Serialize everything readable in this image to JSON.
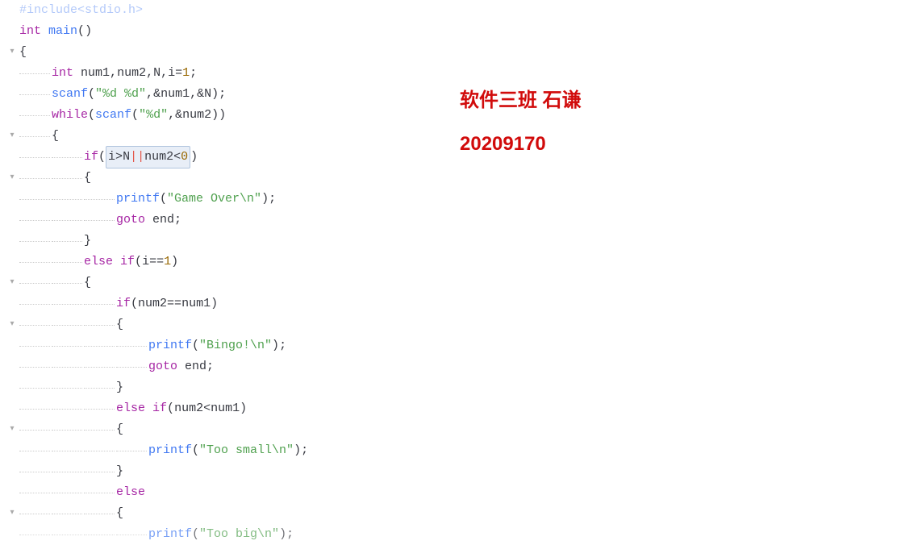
{
  "watermark": {
    "line1": "软件三班 石谦",
    "line2": "20209170"
  },
  "code": {
    "include_line": "#include<stdio.h>",
    "type_int": "int",
    "main_fn": "main",
    "open_paren": "(",
    "close_paren": ")",
    "open_brace": "{",
    "close_brace": "}",
    "var_num1": "num1",
    "var_num2": "num2",
    "var_N": "N",
    "var_i": "i",
    "eq": "=",
    "one": "1",
    "zero": "0",
    "comma": ",",
    "semicolon": ";",
    "scanf_fn": "scanf",
    "printf_fn": "printf",
    "str_fmt1": "\"%d %d\"",
    "str_fmt2": "\"%d\"",
    "amp": "&",
    "while_kw": "while",
    "if_kw": "if",
    "else_kw": "else",
    "goto_kw": "goto",
    "end_label": "end",
    "gt": ">",
    "lt": "<",
    "or_op": "||",
    "eq_eq": "==",
    "str_gameover": "\"Game Over\\n\"",
    "str_bingo": "\"Bingo!\\n\"",
    "str_toosmall": "\"Too small\\n\"",
    "str_toobig": "\"Too big\\n\""
  }
}
